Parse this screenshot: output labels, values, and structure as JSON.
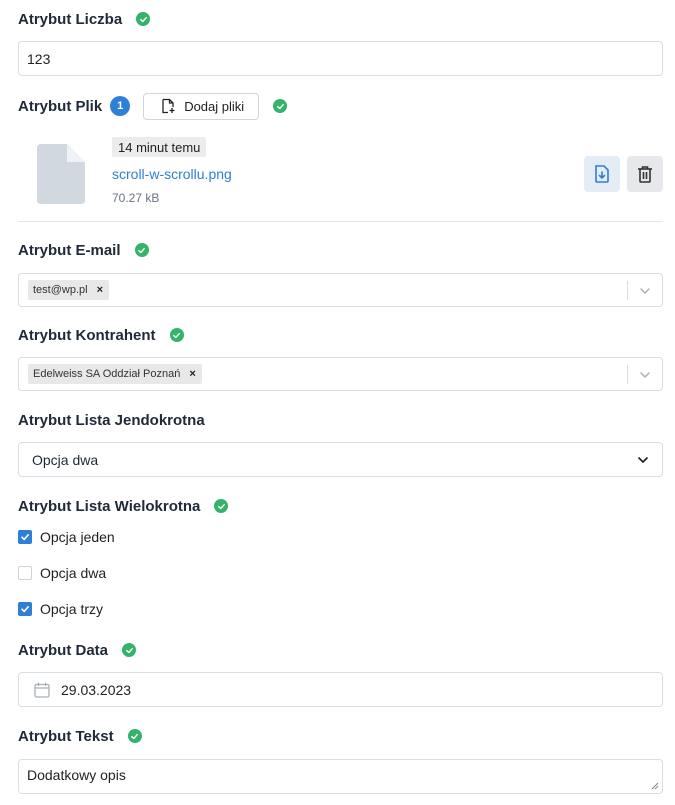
{
  "fields": {
    "liczba": {
      "label": "Atrybut Liczba",
      "value": "123"
    },
    "plik": {
      "label": "Atrybut Plik",
      "count": "1",
      "add_button": "Dodaj pliki",
      "file": {
        "time": "14 minut temu",
        "name": "scroll-w-scrollu.png",
        "size": "70.27 kB"
      }
    },
    "email": {
      "label": "Atrybut E-mail",
      "chip": "test@wp.pl",
      "chip_remove": "×"
    },
    "kontrahent": {
      "label": "Atrybut Kontrahent",
      "chip": "Edelweiss SA Oddział Poznań",
      "chip_remove": "×"
    },
    "lista_jedno": {
      "label": "Atrybut Lista Jendokrotna",
      "selected": "Opcja dwa"
    },
    "lista_wielo": {
      "label": "Atrybut Lista Wielokrotna",
      "options": [
        {
          "label": "Opcja jeden",
          "checked": true
        },
        {
          "label": "Opcja dwa",
          "checked": false
        },
        {
          "label": "Opcja trzy",
          "checked": true
        }
      ]
    },
    "data": {
      "label": "Atrybut Data",
      "value": "29.03.2023"
    },
    "tekst": {
      "label": "Atrybut Tekst",
      "value": "Dodatkowy opis"
    }
  },
  "colors": {
    "success": "#34b36b",
    "accent": "#2f7fd6",
    "border": "#d9dee5"
  },
  "icons": {
    "valid": "check-circle-icon",
    "add_file": "file-plus-icon",
    "file": "file-icon",
    "download": "file-download-icon",
    "delete": "trash-icon",
    "chevron": "chevron-down-icon",
    "calendar": "calendar-icon"
  }
}
